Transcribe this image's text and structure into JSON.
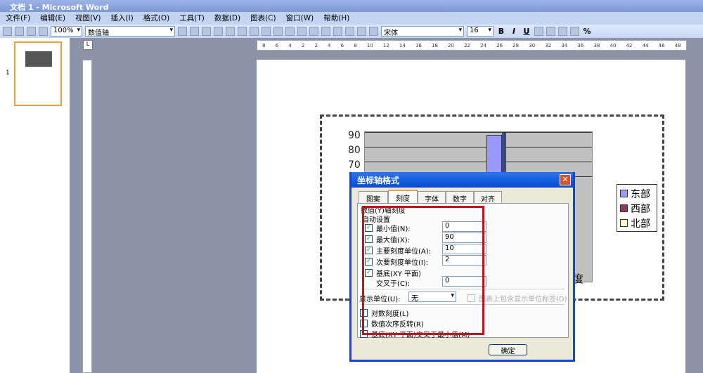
{
  "window": {
    "title": "文档 1 - Microsoft Word"
  },
  "menu": [
    "文件(F)",
    "编辑(E)",
    "视图(V)",
    "插入(I)",
    "格式(O)",
    "工具(T)",
    "数据(D)",
    "图表(C)",
    "窗口(W)",
    "帮助(H)"
  ],
  "toolbar": {
    "zoom": "100%",
    "chart_object": "数值轴",
    "font": "宋体",
    "size": "16",
    "bold": "B",
    "italic": "I",
    "underline": "U",
    "percent": "%"
  },
  "ruler": {
    "ticks": [
      "8",
      "6",
      "4",
      "2",
      "2",
      "4",
      "6",
      "8",
      "10",
      "12",
      "14",
      "16",
      "18",
      "20",
      "22",
      "24",
      "26",
      "28",
      "30",
      "32",
      "34",
      "36",
      "38",
      "40",
      "42",
      "44",
      "46",
      "48"
    ],
    "corner": "L"
  },
  "thumbnails": {
    "page_number": "1"
  },
  "chart": {
    "y_ticks": [
      "90",
      "80",
      "70"
    ],
    "legend": [
      {
        "label": "东部",
        "color": "#9999ff"
      },
      {
        "label": "西部",
        "color": "#993366"
      },
      {
        "label": "北部",
        "color": "#ffffcc"
      }
    ],
    "axis_title_fragment": "度"
  },
  "dialog": {
    "title": "坐标轴格式",
    "tabs": [
      "图案",
      "刻度",
      "字体",
      "数字",
      "对齐"
    ],
    "active_tab": "刻度",
    "section": "数值(Y)轴刻度",
    "auto": "自动设置",
    "fields": [
      {
        "label": "最小值(N):",
        "value": "0",
        "checked": true
      },
      {
        "label": "最大值(X):",
        "value": "90",
        "checked": true
      },
      {
        "label": "主要刻度单位(A):",
        "value": "10",
        "checked": true
      },
      {
        "label": "次要刻度单位(I):",
        "value": "2",
        "checked": true
      }
    ],
    "floor_label": "基底(XY 平面)",
    "cross_label": "交叉于(C):",
    "cross_value": "0",
    "display_unit_label": "显示单位(U):",
    "display_unit": "无",
    "show_label_checkbox": "图表上包含显示单位标签(D)",
    "options": [
      "对数刻度(L)",
      "数值次序反转(R)",
      "基底(XY 平面)交叉于最小值(M)"
    ],
    "ok": "确定"
  }
}
